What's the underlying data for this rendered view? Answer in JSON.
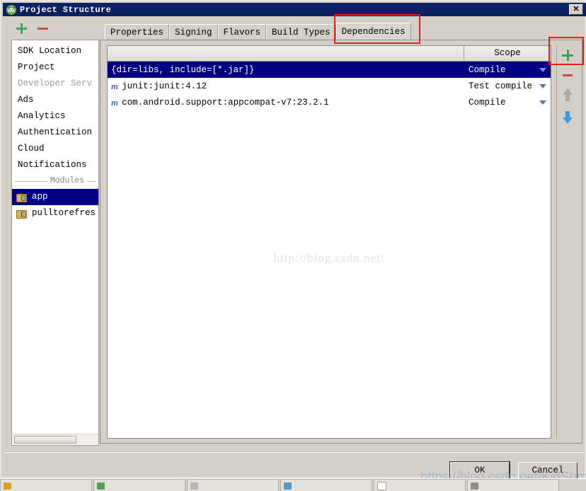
{
  "window": {
    "title": "Project Structure",
    "icon": "android-studio-icon",
    "close_label": "✕"
  },
  "sidebar": {
    "toolbar": {
      "add_label": "+",
      "remove_label": "−"
    },
    "items": [
      {
        "label": "SDK Location",
        "disabled": false
      },
      {
        "label": "Project",
        "disabled": false
      },
      {
        "label": "Developer Serv",
        "disabled": true
      },
      {
        "label": "Ads",
        "disabled": false
      },
      {
        "label": "Analytics",
        "disabled": false
      },
      {
        "label": "Authentication",
        "disabled": false
      },
      {
        "label": "Cloud",
        "disabled": false
      },
      {
        "label": "Notifications",
        "disabled": false
      }
    ],
    "modules_separator": "Modules",
    "modules": [
      {
        "label": "app",
        "selected": true,
        "icon": "app-module-icon"
      },
      {
        "label": "pulltorefres",
        "selected": false,
        "icon": "library-module-icon"
      }
    ]
  },
  "tabs": [
    {
      "label": "Properties",
      "active": false
    },
    {
      "label": "Signing",
      "active": false
    },
    {
      "label": "Flavors",
      "active": false
    },
    {
      "label": "Build Types",
      "active": false
    },
    {
      "label": "Dependencies",
      "active": true
    }
  ],
  "dependencies_table": {
    "columns": [
      "",
      "Scope"
    ],
    "rows": [
      {
        "name": "{dir=libs, include=[*.jar]}",
        "scope": "Compile",
        "has_module_icon": false,
        "selected": true
      },
      {
        "name": "junit:junit:4.12",
        "scope": "Test compile",
        "has_module_icon": true,
        "module_icon_glyph": "m",
        "selected": false
      },
      {
        "name": "com.android.support:appcompat-v7:23.2.1",
        "scope": "Compile",
        "has_module_icon": true,
        "module_icon_glyph": "m",
        "selected": false
      }
    ]
  },
  "row_toolbar": {
    "add_label": "+",
    "remove_label": "−",
    "move_up_label": "▲",
    "move_down_label": "▼"
  },
  "footer": {
    "ok_label": "OK",
    "cancel_label": "Cancel"
  },
  "watermarks": {
    "center": "http://blog.csdn.net/",
    "bottom": "https://blog.csdn.net/KidShmily"
  },
  "colors": {
    "titlebar": "#0a2060",
    "dialog_bg": "#d4d0c8",
    "selection": "#000080",
    "accent_add": "#35a853",
    "accent_remove": "#c0504d",
    "accent_caret": "#3f7fd0",
    "annotation": "#ef1a1a"
  },
  "taskbar": {
    "items": [
      {
        "icon_color": "#e0a21c"
      },
      {
        "icon_color": "#4fa34f"
      },
      {
        "icon_color": "#b7b7b7"
      },
      {
        "icon_color": "#4c9ad8"
      },
      {
        "icon_color": "#ffffff"
      },
      {
        "icon_color": "#8e8e8e"
      }
    ]
  }
}
